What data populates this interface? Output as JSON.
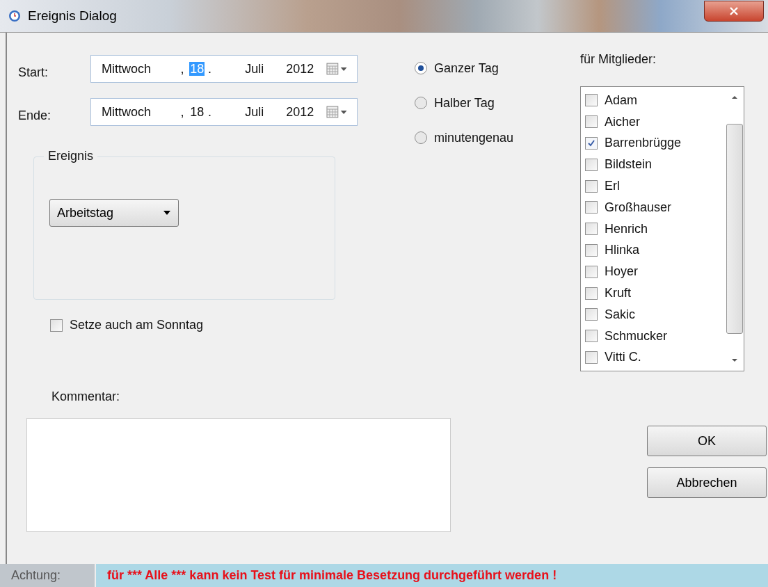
{
  "window": {
    "title": "Ereignis Dialog"
  },
  "start": {
    "label": "Start:",
    "segments": [
      {
        "text": "Mittwoch",
        "selected": false
      },
      {
        "text": ",",
        "selected": false
      },
      {
        "text": "18",
        "selected": true
      },
      {
        "text": ".",
        "selected": false
      },
      {
        "text": "Juli",
        "selected": false
      },
      {
        "text": "2012",
        "selected": false
      }
    ]
  },
  "end": {
    "label": "Ende:",
    "segments": [
      {
        "text": "Mittwoch",
        "selected": false
      },
      {
        "text": ",",
        "selected": false
      },
      {
        "text": "18",
        "selected": false
      },
      {
        "text": ".",
        "selected": false
      },
      {
        "text": "Juli",
        "selected": false
      },
      {
        "text": "2012",
        "selected": false
      }
    ]
  },
  "duration_options": [
    {
      "label": "Ganzer Tag",
      "selected": true
    },
    {
      "label": "Halber Tag",
      "selected": false
    },
    {
      "label": "minutengenau",
      "selected": false
    }
  ],
  "event_group": {
    "title": "Ereignis",
    "dropdown": "Arbeitstag"
  },
  "sunday": {
    "label": "Setze auch am Sonntag",
    "checked": false
  },
  "comment": {
    "label": "Kommentar:"
  },
  "members": {
    "label": "für Mitglieder:",
    "items": [
      {
        "name": "Adam",
        "checked": false
      },
      {
        "name": "Aicher",
        "checked": false
      },
      {
        "name": "Barrenbrügge",
        "checked": true
      },
      {
        "name": "Bildstein",
        "checked": false
      },
      {
        "name": "Erl",
        "checked": false
      },
      {
        "name": "Großhauser",
        "checked": false
      },
      {
        "name": "Henrich",
        "checked": false
      },
      {
        "name": "Hlinka",
        "checked": false
      },
      {
        "name": "Hoyer",
        "checked": false
      },
      {
        "name": "Kruft",
        "checked": false
      },
      {
        "name": "Sakic",
        "checked": false
      },
      {
        "name": "Schmucker",
        "checked": false
      },
      {
        "name": "Vitti C.",
        "checked": false
      }
    ]
  },
  "buttons": [
    "OK",
    "Abbrechen"
  ],
  "status_bar": {
    "label": "Achtung:",
    "message": "für *** Alle *** kann kein Test für minimale Besetzung durchgeführt werden !"
  }
}
